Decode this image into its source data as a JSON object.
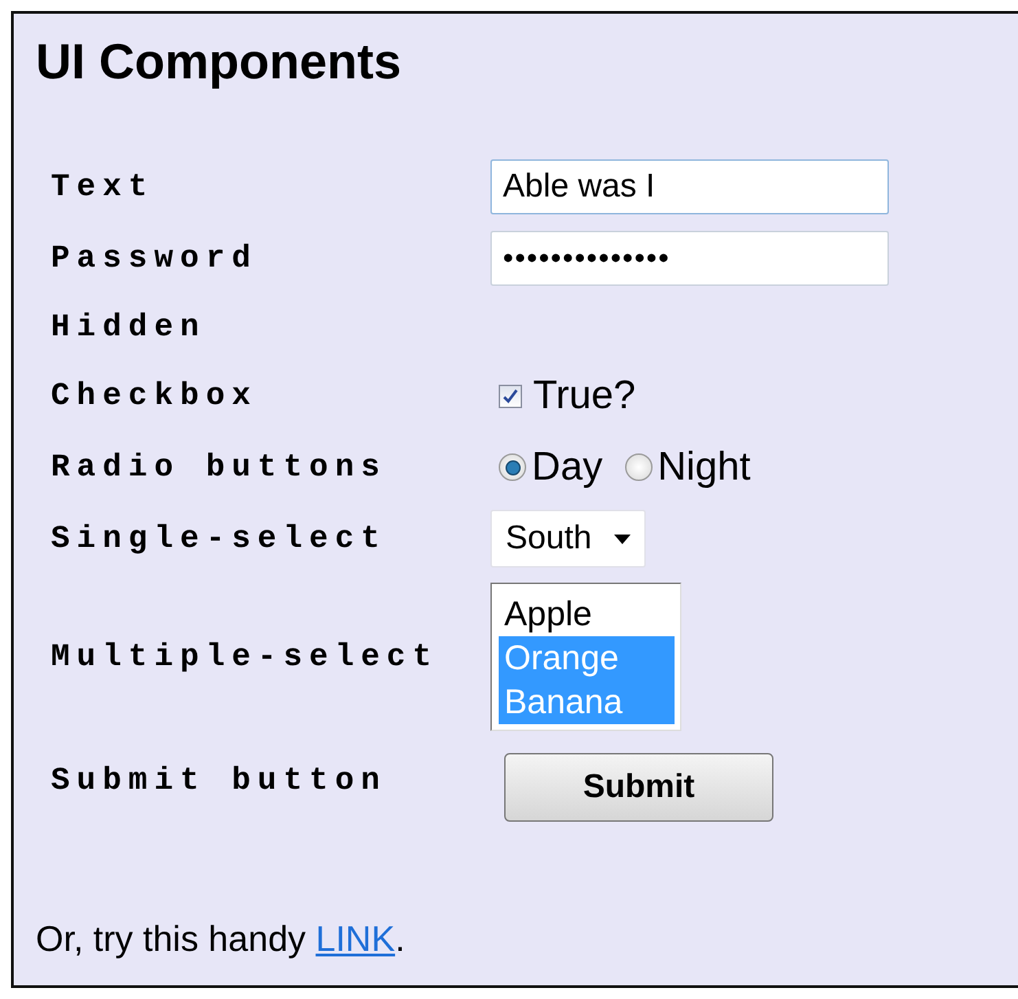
{
  "title": "UI Components",
  "rows": [
    {
      "kind": "text",
      "label": "Text",
      "value": "Able was I"
    },
    {
      "kind": "text",
      "label": "Password",
      "value": "••••••••••••••"
    },
    {
      "kind": "none",
      "label": "Hidden"
    },
    {
      "kind": "checkbox",
      "label": "Checkbox",
      "checked": true,
      "text": "True?"
    },
    {
      "kind": "radio",
      "label": "Radio buttons",
      "options": [
        {
          "text": "Day",
          "selected": true
        },
        {
          "text": "Night",
          "selected": false
        }
      ]
    },
    {
      "kind": "select",
      "label": "Single-select",
      "value": "South"
    },
    {
      "kind": "multiselect",
      "label": "Multiple-select",
      "options": [
        {
          "text": "Apple",
          "selected": false
        },
        {
          "text": "Orange",
          "selected": true
        },
        {
          "text": "Banana",
          "selected": true
        }
      ]
    },
    {
      "kind": "button",
      "label": "Submit button",
      "text": "Submit"
    }
  ],
  "footer": {
    "before": "Or, try this handy ",
    "link": "LINK",
    "after": "."
  }
}
